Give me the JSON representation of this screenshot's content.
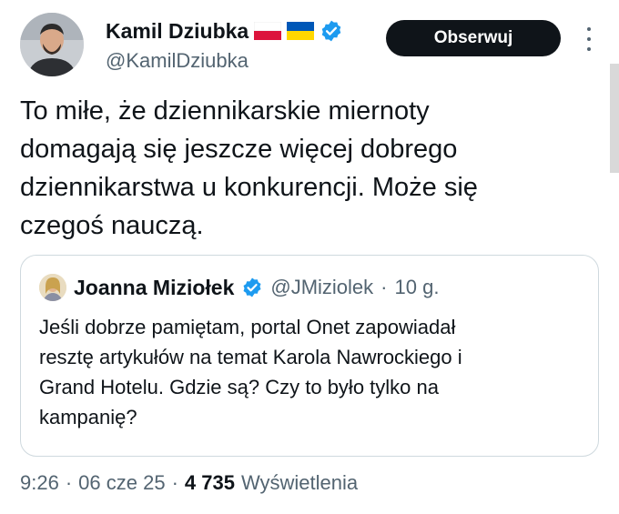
{
  "author": {
    "name": "Kamil Dziubka",
    "handle": "@KamilDziubka",
    "flags": [
      "poland-flag",
      "ukraine-flag"
    ],
    "verified_icon": "verified-badge-icon"
  },
  "follow_button": {
    "label": "Obserwuj"
  },
  "more_icon": "more-vertical-icon",
  "tweet_text": "To miłe, że dziennikarskie miernoty\ndomagają się jeszcze więcej dobrego\ndziennikarstwa u konkurencji. Może się\nczegoś nauczą.",
  "quote": {
    "name": "Joanna Miziołek",
    "handle": "@JMiziolek",
    "separator": "·",
    "time": "10 g.",
    "text": "Jeśli dobrze pamiętam, portal Onet zapowiadał\nresztę artykułów na temat Karola Nawrockiego i\nGrand Hotelu. Gdzie są? Czy to było tylko na\nkampanię?"
  },
  "meta": {
    "time": "9:26",
    "sep1": "·",
    "date": "06 cze 25",
    "sep2": "·",
    "views_count": "4 735",
    "views_label": "Wyświetlenia"
  },
  "colors": {
    "text": "#0f1419",
    "secondary": "#536471",
    "verified": "#1d9bf0",
    "button_bg": "#0f1419",
    "border": "#cfd9de"
  }
}
